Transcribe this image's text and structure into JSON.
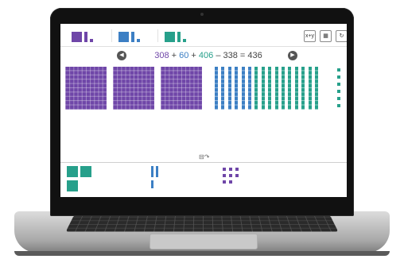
{
  "colors": {
    "purple": "#6f46a8",
    "blue": "#3c7fc4",
    "teal": "#27a08b"
  },
  "toolbar": {
    "groups": [
      {
        "name": "purple-blocks",
        "color": "#6f46a8"
      },
      {
        "name": "blue-blocks",
        "color": "#3c7fc4"
      },
      {
        "name": "teal-blocks",
        "color": "#27a08b"
      }
    ],
    "buttons": [
      {
        "name": "equation-toggle-button",
        "icon": "expression-icon",
        "glyph": "x+y"
      },
      {
        "name": "grid-button",
        "icon": "grid-icon",
        "glyph": "▦"
      },
      {
        "name": "reset-button",
        "icon": "refresh-icon",
        "glyph": "↻"
      }
    ]
  },
  "equation": {
    "prev_icon": "◀",
    "next_icon": "▶",
    "terms": [
      {
        "text": "308",
        "color": "#6f46a8"
      },
      {
        "text": " + ",
        "color": "#444444"
      },
      {
        "text": "60",
        "color": "#3c7fc4"
      },
      {
        "text": " + ",
        "color": "#444444"
      },
      {
        "text": "406",
        "color": "#27a08b"
      },
      {
        "text": " – 338 = 436",
        "color": "#444444"
      }
    ]
  },
  "workspace": {
    "hundreds": 3,
    "tens": [
      {
        "color": "#3c7fc4",
        "count": 6
      },
      {
        "color": "#27a08b",
        "count": 10
      }
    ],
    "ones": 6
  },
  "tray": {
    "handle_glyph": "⊟↷"
  }
}
